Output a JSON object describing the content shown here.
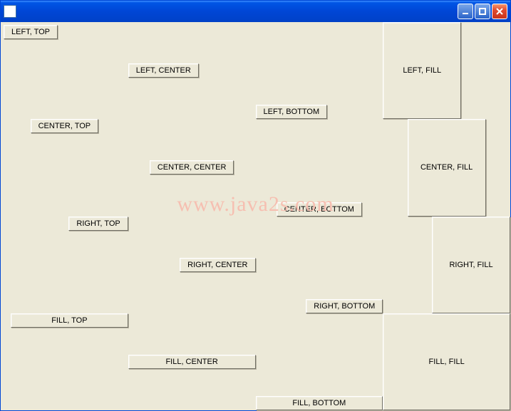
{
  "titlebar": {
    "title": ""
  },
  "watermark": "www.java2s.com",
  "buttons": {
    "r0c0": "LEFT, TOP",
    "r0c1": "LEFT, CENTER",
    "r0c2": "LEFT, BOTTOM",
    "r0c3": "LEFT, FILL",
    "r1c0": "CENTER, TOP",
    "r1c1": "CENTER, CENTER",
    "r1c2": "CENTER, BOTTOM",
    "r1c3": "CENTER, FILL",
    "r2c0": "RIGHT, TOP",
    "r2c1": "RIGHT, CENTER",
    "r2c2": "RIGHT, BOTTOM",
    "r2c3": "RIGHT, FILL",
    "r3c0": "FILL, TOP",
    "r3c1": "FILL, CENTER",
    "r3c2": "FILL, BOTTOM",
    "r3c3": "FILL, FILL"
  }
}
